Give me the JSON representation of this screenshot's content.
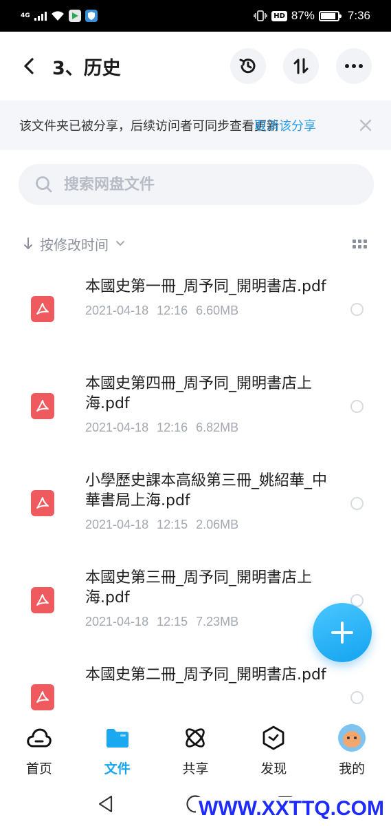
{
  "status_bar": {
    "network": "4G",
    "hd_badge": "HD",
    "battery_text": "87%",
    "battery_level": 0.87,
    "time": "7:36"
  },
  "header": {
    "title": "3、历史",
    "back_icon": "chevron-left-icon",
    "actions": [
      "history-icon",
      "sort-arrows-icon",
      "more-icon"
    ]
  },
  "banner": {
    "text": "该文件夹已被分享，后续访问者可同步查看更新",
    "link": "取消该分享"
  },
  "search": {
    "placeholder": "搜索网盘文件"
  },
  "sort": {
    "label": "按修改时间"
  },
  "files": [
    {
      "name": "本國史第一冊_周予同_開明書店.pdf",
      "date": "2021-04-18",
      "time": "12:16",
      "size": "6.60MB"
    },
    {
      "name": "本國史第四冊_周予同_開明書店上海.pdf",
      "date": "2021-04-18",
      "time": "12:16",
      "size": "6.82MB"
    },
    {
      "name": "小學歷史課本高級第三冊_姚紹華_中華書局上海.pdf",
      "date": "2021-04-18",
      "time": "12:15",
      "size": "2.06MB"
    },
    {
      "name": "本國史第三冊_周予同_開明書店上海.pdf",
      "date": "2021-04-18",
      "time": "12:15",
      "size": "7.23MB"
    },
    {
      "name": "本國史第二冊_周予同_開明書店.pdf",
      "date": "",
      "time": "",
      "size": ""
    }
  ],
  "bottom_nav": [
    {
      "label": "首页",
      "icon": "cloud-icon",
      "active": false
    },
    {
      "label": "文件",
      "icon": "folder-icon",
      "active": true
    },
    {
      "label": "共享",
      "icon": "atom-icon",
      "active": false
    },
    {
      "label": "发现",
      "icon": "discover-icon",
      "active": false
    },
    {
      "label": "我的",
      "icon": "avatar",
      "active": false
    }
  ],
  "watermark": "WWW.XXTTQ.COM",
  "colors": {
    "accent": "#16a4ee",
    "pdf": "#ef5a5f",
    "banner_link": "#2a9dea"
  }
}
